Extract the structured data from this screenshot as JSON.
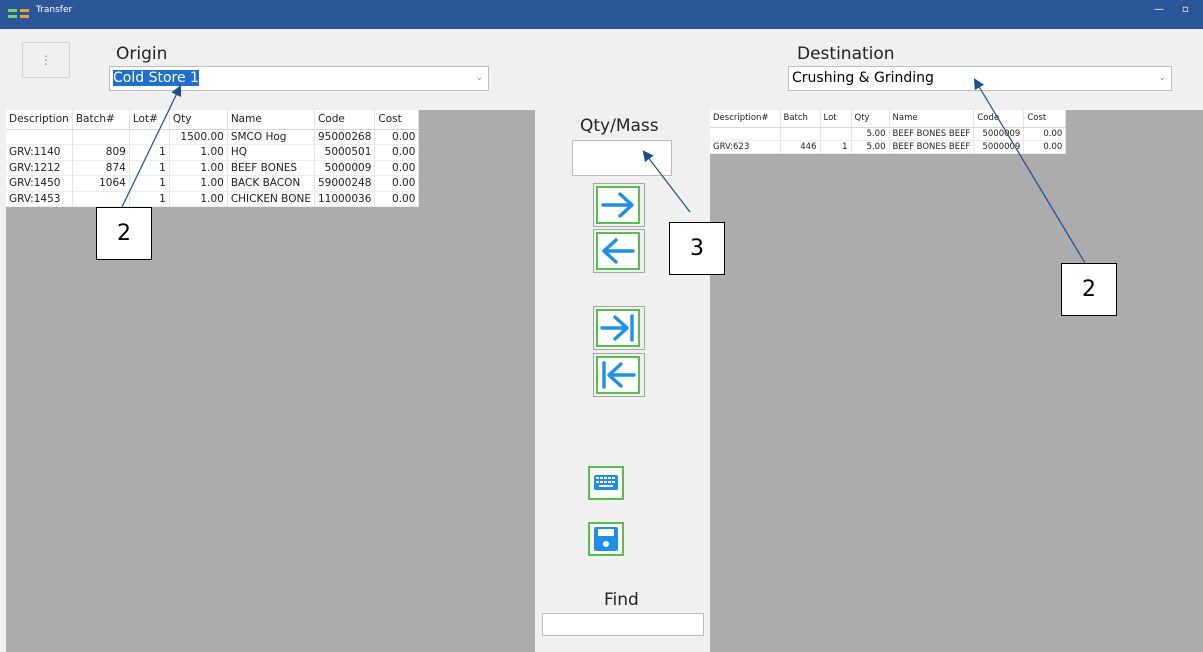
{
  "window": {
    "title": "Transfer",
    "minimize_glyph": "—",
    "restore_glyph": "▫"
  },
  "menu_button": {
    "glyph": "⋮"
  },
  "origin": {
    "label": "Origin",
    "selected": "Cold Store 1",
    "table": {
      "columns": [
        "Description",
        "Batch#",
        "Lot#",
        "Qty",
        "Name",
        "Code",
        "Cost"
      ],
      "rows": [
        [
          "",
          "",
          "",
          "1500.00",
          "SMCO Hog",
          "95000268",
          "0.00"
        ],
        [
          "GRV:1140",
          "809",
          "1",
          "1.00",
          "HQ",
          "5000501",
          "0.00"
        ],
        [
          "GRV:1212",
          "874",
          "1",
          "1.00",
          "BEEF BONES",
          "5000009",
          "0.00"
        ],
        [
          "GRV:1450",
          "1064",
          "1",
          "1.00",
          "BACK BACON",
          "59000248",
          "0.00"
        ],
        [
          "GRV:1453",
          "",
          "1",
          "1.00",
          "CHICKEN BONE",
          "11000036",
          "0.00"
        ]
      ]
    }
  },
  "destination": {
    "label": "Destination",
    "selected": "Crushing & Grinding",
    "table": {
      "columns": [
        "Description#",
        "Batch",
        "Lot",
        "Qty",
        "Name",
        "Code",
        "Cost"
      ],
      "rows": [
        [
          "",
          "",
          "",
          "5.00",
          "BEEF BONES BEEF",
          "5000009",
          "0.00"
        ],
        [
          "GRV:623",
          "446",
          "1",
          "5.00",
          "BEEF BONES BEEF",
          "5000009",
          "0.00"
        ]
      ]
    }
  },
  "qty": {
    "label": "Qty/Mass",
    "value": ""
  },
  "find": {
    "label": "Find",
    "value": ""
  },
  "buttons": {
    "move_right": "arrow-right-icon",
    "move_left": "arrow-left-icon",
    "move_all_right": "arrow-right-to-bar-icon",
    "move_all_left": "arrow-left-to-bar-icon",
    "keyboard": "keyboard-icon",
    "save": "save-icon"
  },
  "annotations": [
    "2",
    "3",
    "2"
  ],
  "colors": {
    "titlebar": "#2b579a",
    "arrow_blue": "#1e8fe6",
    "button_green": "#55c04a",
    "grid_bg": "#acacac",
    "selection": "#1f6fd1",
    "annotation_line": "#1f4e8c"
  }
}
